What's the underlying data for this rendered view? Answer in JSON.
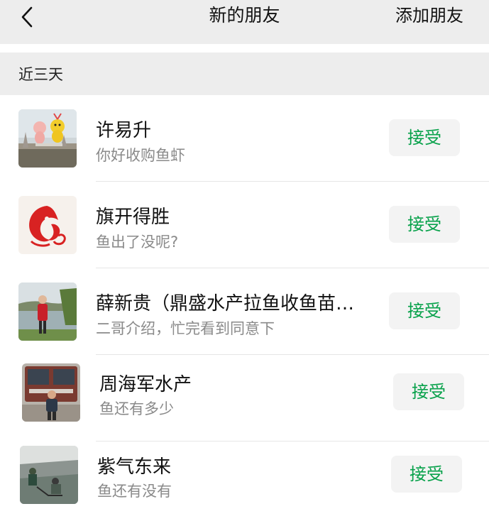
{
  "header": {
    "back_icon": "chevron-left-icon",
    "title": "新的朋友",
    "add_friend_label": "添加朋友"
  },
  "section": {
    "title": "近三天"
  },
  "requests": [
    {
      "name": "许易升",
      "message": "你好收购鱼虾",
      "accept_label": "接受"
    },
    {
      "name": "旗开得胜",
      "message": "鱼出了没呢?",
      "accept_label": "接受"
    },
    {
      "name": "薛新贵（鼎盛水产拉鱼收鱼苗…",
      "message": "二哥介绍，忙完看到同意下",
      "accept_label": "接受"
    },
    {
      "name": "周海军水产",
      "message": "鱼还有多少",
      "accept_label": "接受"
    },
    {
      "name": "紫气东来",
      "message": "鱼还有没有",
      "accept_label": "接受"
    }
  ],
  "colors": {
    "accept_text": "#07a14a",
    "accept_bg": "#f3f3f3",
    "header_bg": "#ededed",
    "subtitle": "#8a8a8a"
  }
}
